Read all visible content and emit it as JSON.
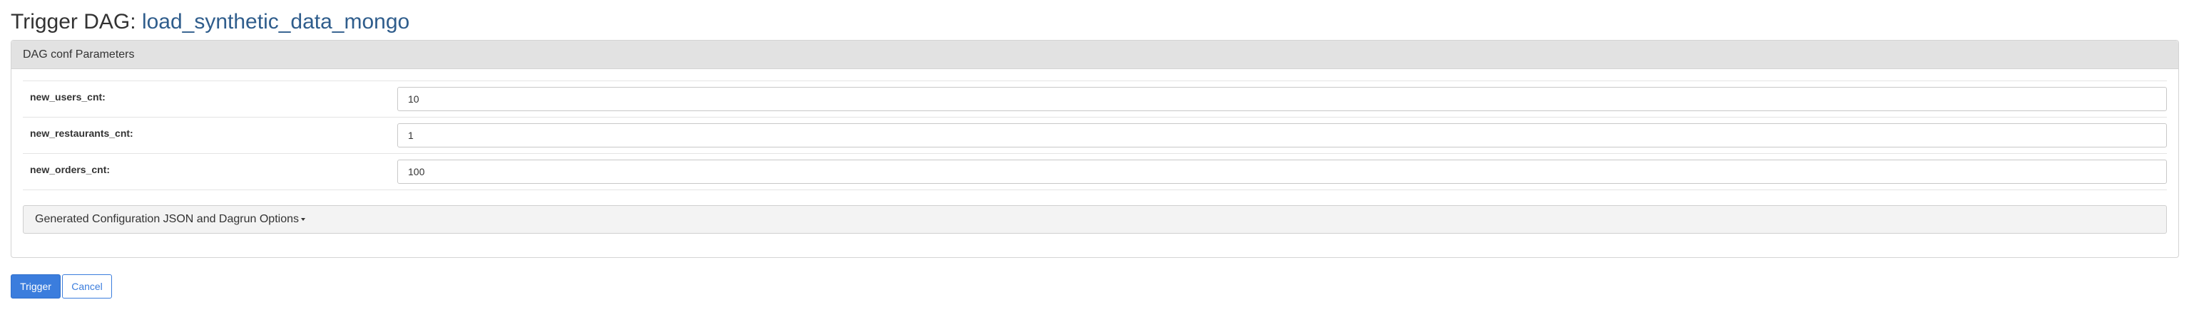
{
  "header": {
    "prefix": "Trigger DAG: ",
    "dag_id": "load_synthetic_data_mongo"
  },
  "panel": {
    "heading": "DAG conf Parameters"
  },
  "params": [
    {
      "label": "new_users_cnt:",
      "value": "10"
    },
    {
      "label": "new_restaurants_cnt:",
      "value": "1"
    },
    {
      "label": "new_orders_cnt:",
      "value": "100"
    }
  ],
  "generated_config": {
    "label": "Generated Configuration JSON and Dagrun Options",
    "icon": "caret-down-icon"
  },
  "actions": {
    "trigger_label": "Trigger",
    "cancel_label": "Cancel"
  },
  "colors": {
    "primary": "#3b7ddd",
    "dag_link": "#2f5d8c",
    "panel_heading_bg": "#e2e2e2"
  }
}
